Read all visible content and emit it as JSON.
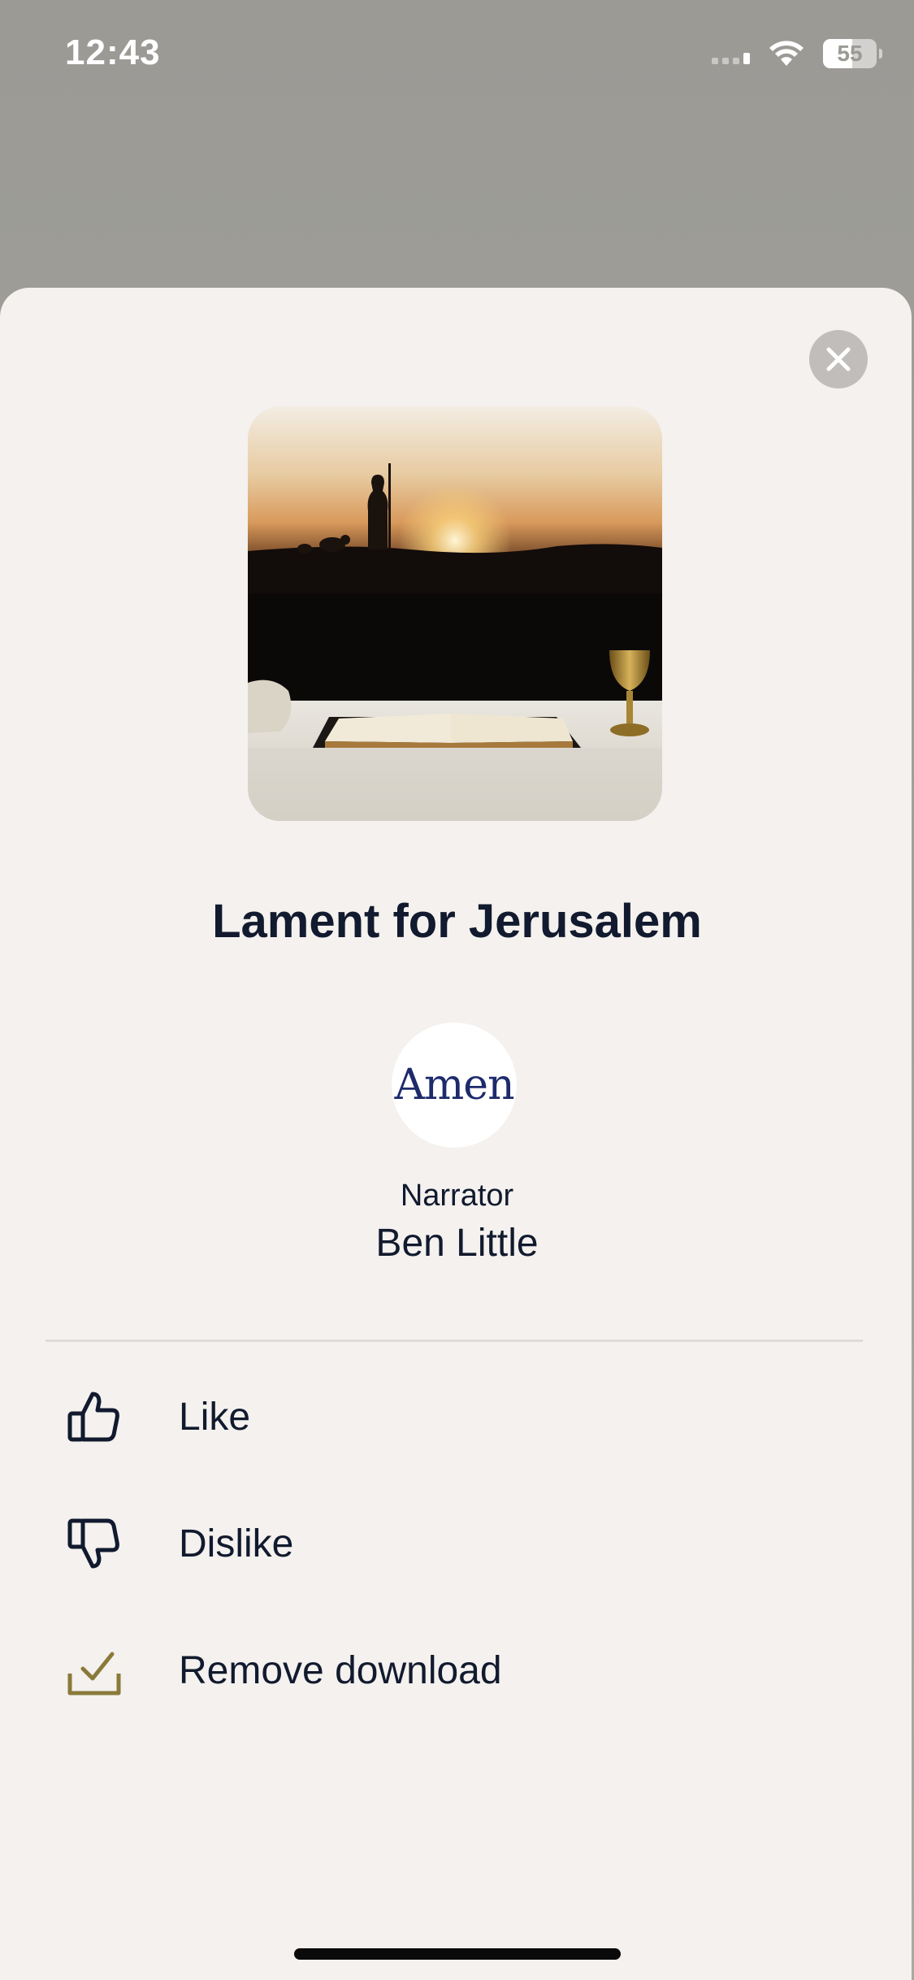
{
  "status_bar": {
    "time": "12:43",
    "battery": "55"
  },
  "sheet": {
    "close_icon": "close-icon",
    "title": "Lament for Jerusalem",
    "avatar_text": "Amen",
    "narrator_label": "Narrator",
    "narrator_name": "Ben Little",
    "actions": [
      {
        "label": "Like",
        "icon": "thumbs-up-icon"
      },
      {
        "label": "Dislike",
        "icon": "thumbs-down-icon"
      },
      {
        "label": "Remove download",
        "icon": "downloaded-check-icon"
      }
    ]
  },
  "colors": {
    "background": "#9b9a95",
    "sheet": "#f4f1ee",
    "text": "#111a2e",
    "download_accent": "#8a7a3a"
  }
}
